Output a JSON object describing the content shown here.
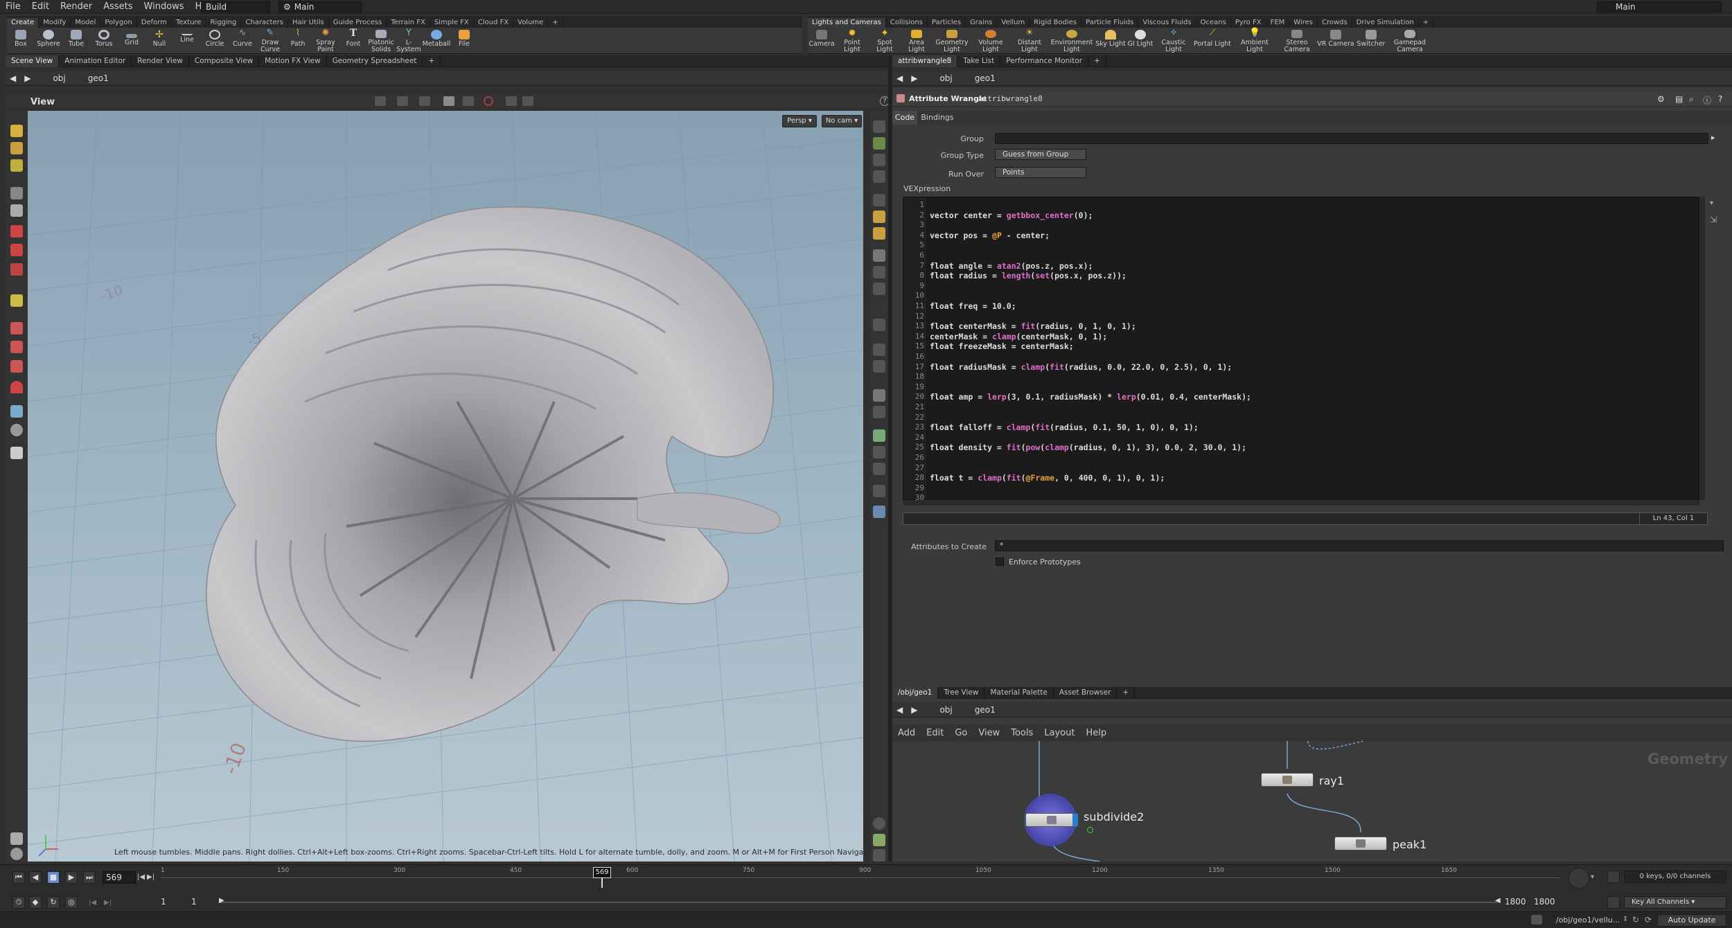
{
  "menu": [
    "File",
    "Edit",
    "Render",
    "Assets",
    "Windows",
    "Help"
  ],
  "desktop": {
    "build": "Build",
    "main": "Main",
    "right_main": "Main"
  },
  "shelf_left": {
    "tabs": [
      "Create",
      "Modify",
      "Model",
      "Polygon",
      "Deform",
      "Texture",
      "Rigging",
      "Characters",
      "Hair Utils",
      "Guide Process",
      "Terrain FX",
      "Simple FX",
      "Cloud FX",
      "Volume"
    ],
    "tools": [
      "Box",
      "Sphere",
      "Tube",
      "Torus",
      "Grid",
      "Null",
      "Line",
      "Circle",
      "Curve",
      "Draw Curve",
      "Path",
      "Spray Paint",
      "Font",
      "Platonic Solids",
      "L-System",
      "Metaball",
      "File"
    ]
  },
  "shelf_right": {
    "tabs": [
      "Lights and Cameras",
      "Collisions",
      "Particles",
      "Grains",
      "Vellum",
      "Rigid Bodies",
      "Particle Fluids",
      "Viscous Fluids",
      "Oceans",
      "Pyro FX",
      "FEM",
      "Wires",
      "Crowds",
      "Drive Simulation"
    ],
    "tools": [
      "Camera",
      "Point Light",
      "Spot Light",
      "Area Light",
      "Geometry Light",
      "Volume Light",
      "Distant Light",
      "Environment Light",
      "Sky Light",
      "GI Light",
      "Caustic Light",
      "Portal Light",
      "Ambient Light",
      "Stereo Camera",
      "VR Camera",
      "Switcher",
      "Gamepad Camera"
    ]
  },
  "left_pane": {
    "tabs": [
      "Scene View",
      "Animation Editor",
      "Render View",
      "Composite View",
      "Motion FX View",
      "Geometry Spreadsheet"
    ],
    "path": [
      "obj",
      "geo1"
    ],
    "view_label": "View",
    "persp": "Persp",
    "cam": "No cam",
    "hint": "Left mouse tumbles. Middle pans. Right dollies. Ctrl+Alt+Left box-zooms. Ctrl+Right zooms. Spacebar-Ctrl-Left tilts. Hold L for alternate tumble, dolly, and zoom.    M or Alt+M for First Person Navigation.",
    "grid_labels": [
      "-10",
      "-5",
      "-5",
      "5",
      "-10",
      "5"
    ]
  },
  "right_pane": {
    "tabs": [
      "attribwrangle8",
      "Take List",
      "Performance Monitor"
    ],
    "path": [
      "obj",
      "geo1"
    ],
    "node_type": "Attribute Wrangle",
    "node_name": "attribwrangle8",
    "param_tabs": [
      "Code",
      "Bindings"
    ],
    "group_label": "Group",
    "group_value": "",
    "group_type_label": "Group Type",
    "group_type_value": "Guess from Group",
    "run_over_label": "Run Over",
    "run_over_value": "Points",
    "vex_label": "VEXpression",
    "code_lines": [
      "",
      "vector center = getbbox_center(0);",
      "",
      "vector pos = @P - center;",
      "",
      "",
      "float angle = atan2(pos.z, pos.x);",
      "float radius = length(set(pos.x, pos.z));",
      "",
      "",
      "float freq = 10.0;",
      "",
      "float centerMask = fit(radius, 0, 1, 0, 1);",
      "centerMask = clamp(centerMask, 0, 1);",
      "float freezeMask = centerMask;",
      "",
      "float radiusMask = clamp(fit(radius, 0.0, 22.0, 0, 2.5), 0, 1);",
      "",
      "",
      "float amp = lerp(3, 0.1, radiusMask) * lerp(0.01, 0.4, centerMask);",
      "",
      "",
      "float falloff = clamp(fit(radius, 0.1, 50, 1, 0), 0, 1);",
      "",
      "float density = fit(pow(clamp(radius, 0, 1), 3), 0.0, 2, 30.0, 1);",
      "",
      "",
      "float t = clamp(fit(@Frame, 0, 400, 0, 1), 0, 1);",
      "",
      ""
    ],
    "cursor_pos": "Ln 43, Col 1",
    "attrs_label": "Attributes to Create",
    "attrs_value": "*",
    "enforce_label": "Enforce Prototypes"
  },
  "network_pane": {
    "tabs": [
      "/obj/geo1",
      "Tree View",
      "Material Palette",
      "Asset Browser"
    ],
    "path": [
      "obj",
      "geo1"
    ],
    "menu": [
      "Add",
      "Edit",
      "Go",
      "View",
      "Tools",
      "Layout",
      "Help"
    ],
    "context": "Geometry",
    "nodes": [
      "ray1",
      "subdivide2",
      "peak1"
    ]
  },
  "timeline": {
    "frame": "569",
    "ticks": [
      "1",
      "150",
      "300",
      "450",
      "600",
      "750",
      "900",
      "1050",
      "1200",
      "1350",
      "1500",
      "1650"
    ],
    "cursor": "569",
    "start": "1",
    "start2": "1",
    "end": "1800",
    "end2": "1800",
    "keys": "0 keys, 0/0 channels",
    "key_all": "Key All Channels"
  },
  "status": {
    "path": "/obj/geo1/vellu...",
    "update": "Auto Update"
  }
}
